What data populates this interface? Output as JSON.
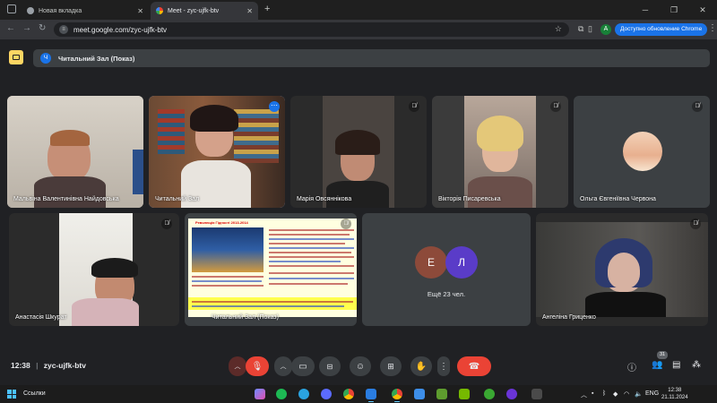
{
  "browser": {
    "tabs": [
      {
        "title": "Новая вкладка",
        "active": false
      },
      {
        "title": "Meet - zyc-ujfk-btv",
        "active": true
      }
    ],
    "url": "meet.google.com/zyc-ujfk-btv",
    "profile_initial": "A",
    "update_label": "Доступно обновление Chrome",
    "colors": {
      "accent": "#1a73e8",
      "tab_active": "#35363a"
    }
  },
  "meeting": {
    "presenter_avatar": "Ч",
    "presenting_title": "Читальний Зал (Показ)",
    "code": "zyc-ujfk-btv",
    "time": "12:38"
  },
  "participants": [
    {
      "name": "Мальвіна Валентинівна Найдовська",
      "muted": false
    },
    {
      "name": "Читальний Зал",
      "muted": false,
      "selected": true
    },
    {
      "name": "Марія Овсяннікова",
      "muted": true
    },
    {
      "name": "Вікторія Писаревська",
      "muted": true
    },
    {
      "name": "Ольга Євгеніївна Червона",
      "muted": true
    },
    {
      "name": "Анастасія Шкурат",
      "muted": true
    },
    {
      "name": "Читальний Зал (Показ)",
      "muted": true
    },
    {
      "name": "Ангеліна Гриценко",
      "muted": true
    }
  ],
  "presentation": {
    "slide_title": "Революція Гідності 2013-2014"
  },
  "others": {
    "avatars": [
      {
        "initial": "Е",
        "color": "#8d4a3a"
      },
      {
        "initial": "Л",
        "color": "#5a3cc8"
      }
    ],
    "label": "Ещё 23 чел."
  },
  "controls": {
    "participants_count": "31"
  },
  "taskbar": {
    "links_label": "Ссылки",
    "lang": "ENG",
    "clock_time": "12:38",
    "clock_date": "21.11.2024"
  }
}
